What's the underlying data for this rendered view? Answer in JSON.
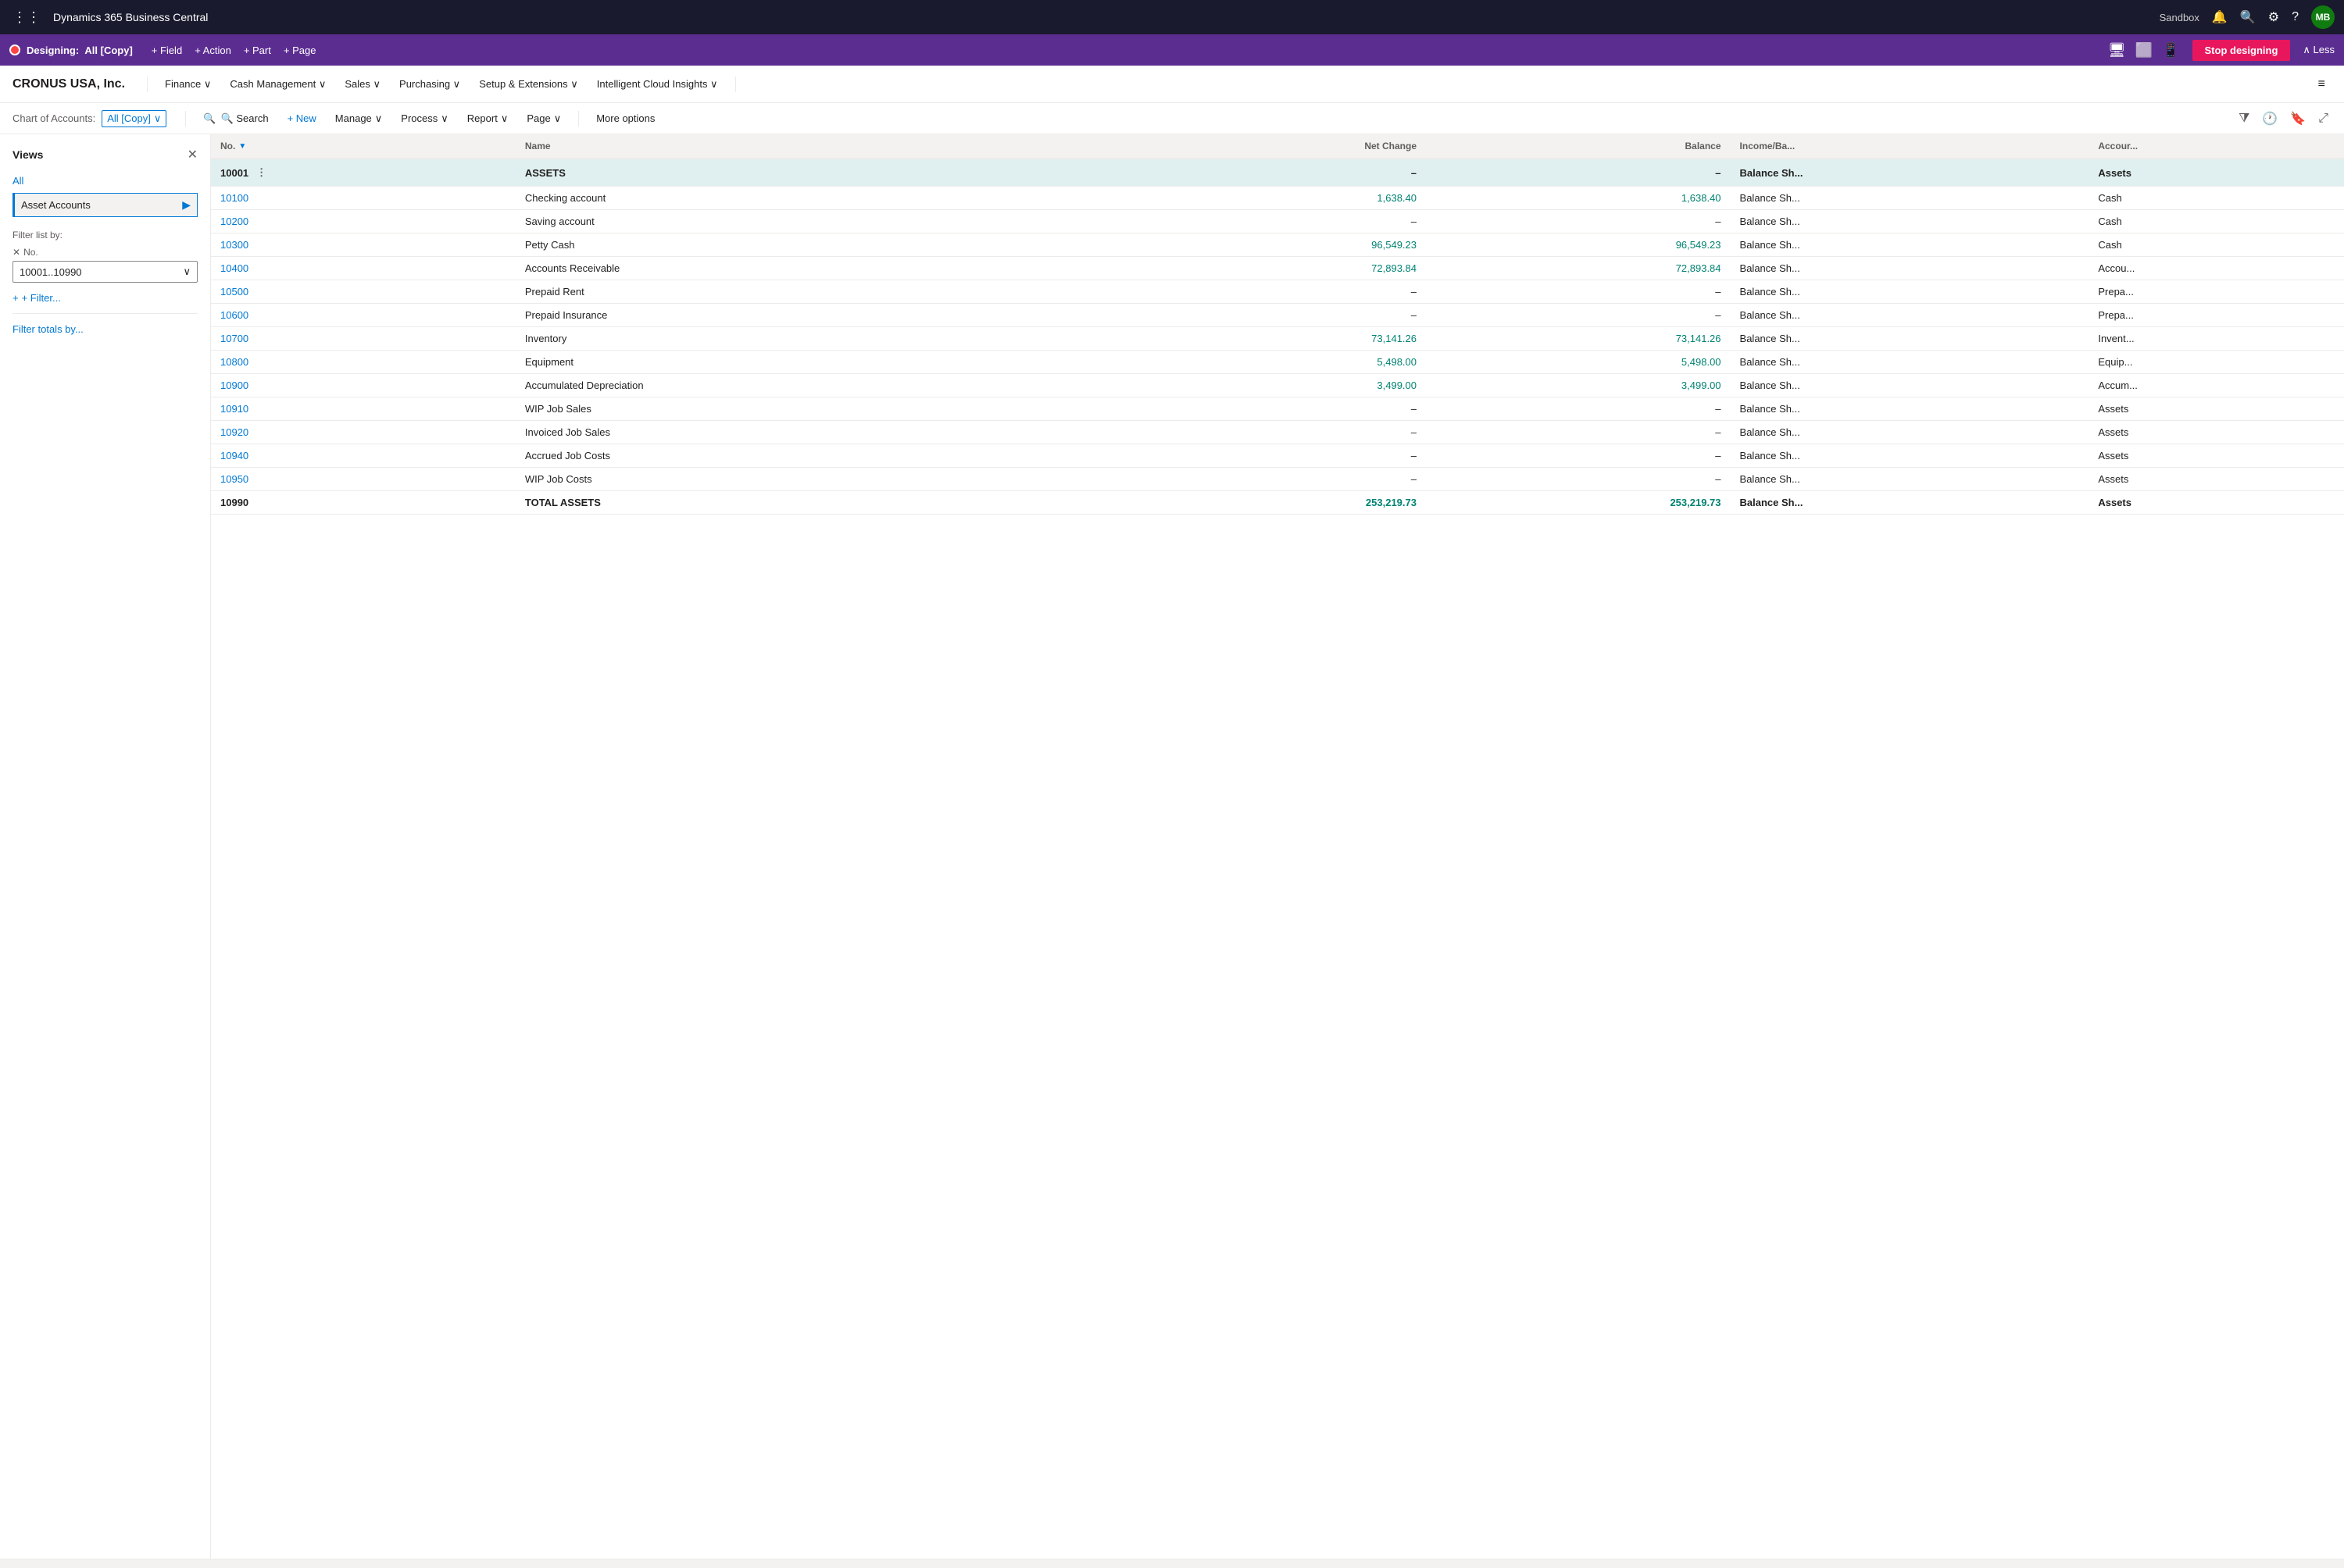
{
  "app": {
    "title": "Dynamics 365 Business Central",
    "environment": "Sandbox"
  },
  "designer_bar": {
    "designing_label": "Designing:",
    "copy_label": "All [Copy]",
    "actions": [
      {
        "label": "+ Field",
        "name": "add-field"
      },
      {
        "label": "+ Action",
        "name": "add-action"
      },
      {
        "label": "+ Part",
        "name": "add-part"
      },
      {
        "label": "+ Page",
        "name": "add-page"
      }
    ],
    "stop_label": "Stop designing",
    "less_label": "∧ Less"
  },
  "menu": {
    "company": "CRONUS USA, Inc.",
    "items": [
      {
        "label": "Finance",
        "name": "finance"
      },
      {
        "label": "Cash Management",
        "name": "cash-management"
      },
      {
        "label": "Sales",
        "name": "sales"
      },
      {
        "label": "Purchasing",
        "name": "purchasing"
      },
      {
        "label": "Setup & Extensions",
        "name": "setup"
      },
      {
        "label": "Intelligent Cloud Insights",
        "name": "cloud-insights"
      }
    ]
  },
  "toolbar": {
    "breadcrumb_label": "Chart of Accounts:",
    "breadcrumb_value": "All [Copy]",
    "search_label": "🔍 Search",
    "new_label": "+ New",
    "manage_label": "Manage",
    "process_label": "Process",
    "report_label": "Report",
    "page_label": "Page",
    "more_options": "More options"
  },
  "views_panel": {
    "title": "Views",
    "all_label": "All",
    "selected_view": "Asset Accounts",
    "filter_list_label": "Filter list by:",
    "filter_tag": "No.",
    "filter_value": "10001..10990",
    "filter_add_label": "+ Filter...",
    "filter_totals_label": "Filter totals by..."
  },
  "table": {
    "columns": [
      {
        "label": "No.",
        "key": "no",
        "has_filter": true
      },
      {
        "label": "Name",
        "key": "name"
      },
      {
        "label": "Net Change",
        "key": "net_change",
        "align": "right"
      },
      {
        "label": "Balance",
        "key": "balance",
        "align": "right"
      },
      {
        "label": "Income/Ba...",
        "key": "income_balance"
      },
      {
        "label": "Accour...",
        "key": "account_type"
      }
    ],
    "rows": [
      {
        "no": "10001",
        "name": "ASSETS",
        "net_change": "",
        "balance": "",
        "income_balance": "Balance Sh...",
        "account_type": "Assets",
        "type": "header",
        "has_actions": true
      },
      {
        "no": "10100",
        "name": "Checking account",
        "net_change": "1,638.40",
        "balance": "1,638.40",
        "income_balance": "Balance Sh...",
        "account_type": "Cash",
        "type": "data",
        "link": true
      },
      {
        "no": "10200",
        "name": "Saving account",
        "net_change": "–",
        "balance": "–",
        "income_balance": "Balance Sh...",
        "account_type": "Cash",
        "type": "data",
        "link": true
      },
      {
        "no": "10300",
        "name": "Petty Cash",
        "net_change": "96,549.23",
        "balance": "96,549.23",
        "income_balance": "Balance Sh...",
        "account_type": "Cash",
        "type": "data",
        "link": true
      },
      {
        "no": "10400",
        "name": "Accounts Receivable",
        "net_change": "72,893.84",
        "balance": "72,893.84",
        "income_balance": "Balance Sh...",
        "account_type": "Accou...",
        "type": "data",
        "link": true
      },
      {
        "no": "10500",
        "name": "Prepaid Rent",
        "net_change": "–",
        "balance": "–",
        "income_balance": "Balance Sh...",
        "account_type": "Prepa...",
        "type": "data",
        "link": true
      },
      {
        "no": "10600",
        "name": "Prepaid Insurance",
        "net_change": "–",
        "balance": "–",
        "income_balance": "Balance Sh...",
        "account_type": "Prepa...",
        "type": "data",
        "link": true
      },
      {
        "no": "10700",
        "name": "Inventory",
        "net_change": "73,141.26",
        "balance": "73,141.26",
        "income_balance": "Balance Sh...",
        "account_type": "Invent...",
        "type": "data",
        "link": true
      },
      {
        "no": "10800",
        "name": "Equipment",
        "net_change": "5,498.00",
        "balance": "5,498.00",
        "income_balance": "Balance Sh...",
        "account_type": "Equip...",
        "type": "data",
        "link": true
      },
      {
        "no": "10900",
        "name": "Accumulated Depreciation",
        "net_change": "3,499.00",
        "balance": "3,499.00",
        "income_balance": "Balance Sh...",
        "account_type": "Accum...",
        "type": "data",
        "link": true
      },
      {
        "no": "10910",
        "name": "WIP Job Sales",
        "net_change": "–",
        "balance": "–",
        "income_balance": "Balance Sh...",
        "account_type": "Assets",
        "type": "data",
        "link": true
      },
      {
        "no": "10920",
        "name": "Invoiced Job Sales",
        "net_change": "–",
        "balance": "–",
        "income_balance": "Balance Sh...",
        "account_type": "Assets",
        "type": "data",
        "link": true
      },
      {
        "no": "10940",
        "name": "Accrued Job Costs",
        "net_change": "–",
        "balance": "–",
        "income_balance": "Balance Sh...",
        "account_type": "Assets",
        "type": "data",
        "link": true
      },
      {
        "no": "10950",
        "name": "WIP Job Costs",
        "net_change": "–",
        "balance": "–",
        "income_balance": "Balance Sh...",
        "account_type": "Assets",
        "type": "data",
        "link": true
      },
      {
        "no": "10990",
        "name": "TOTAL ASSETS",
        "net_change": "253,219.73",
        "balance": "253,219.73",
        "income_balance": "Balance Sh...",
        "account_type": "Assets",
        "type": "total"
      }
    ]
  },
  "icons": {
    "waffle": "⋮⋮⋮",
    "bell": "🔔",
    "search": "🔍",
    "gear": "⚙",
    "help": "?",
    "avatar": "MB",
    "close": "✕",
    "chevron_down": "∨",
    "chevron_up": "∧",
    "filter": "▼",
    "bookmark": "🔖",
    "expand": "⤢",
    "more": "⋮",
    "desktop": "🖥",
    "tablet": "⬜",
    "mobile": "📱",
    "funnel": "⧩",
    "clock": "🕐"
  }
}
